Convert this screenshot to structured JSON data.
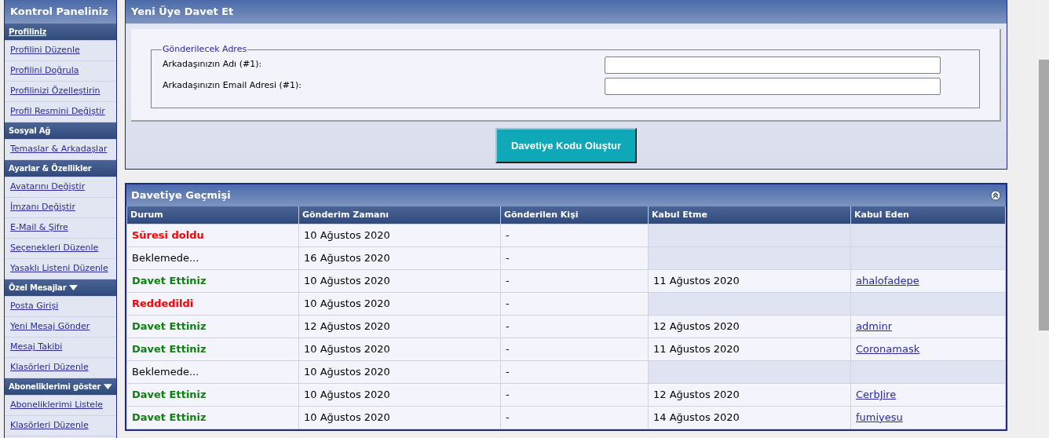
{
  "sidebar": {
    "title": "Kontrol Paneliniz",
    "sections": [
      {
        "label": "Profiliniz",
        "kind": "link",
        "items": [
          "Profilini Düzenle",
          "Profilini Doğrula",
          "Profilinizi Özelleştirin",
          "Profil Resmini Değiştir"
        ]
      },
      {
        "label": "Sosyal Ağ",
        "kind": "plain",
        "items": [
          "Temaslar & Arkadaşlar"
        ]
      },
      {
        "label": "Ayarlar & Özellikler",
        "kind": "plain",
        "items": [
          "Avatarını Değiştir",
          "İmzanı Değiştir",
          "E-Mail & Şifre",
          "Seçenekleri Düzenle",
          "Yasaklı Listeni Düzenle"
        ]
      },
      {
        "label": "Özel Mesajlar",
        "kind": "dropdown",
        "items": [
          "Posta Girişi",
          "Yeni Mesaj Gönder",
          "Mesaj Takibi",
          "Klasörleri Düzenle"
        ]
      },
      {
        "label": "Aboneliklerimi göster",
        "kind": "dropdown",
        "items": [
          "Aboneliklerimi Listele",
          "Klasörleri Düzenle"
        ]
      }
    ]
  },
  "invite": {
    "title": "Yeni Üye Davet Et",
    "legend": "Gönderilecek Adres",
    "fields": [
      {
        "label": "Arkadaşınızın Adı (#1):"
      },
      {
        "label": "Arkadaşınızın Email Adresi (#1):"
      }
    ],
    "button": "Davetiye Kodu Oluştur"
  },
  "history": {
    "title": "Davetiye Geçmişi",
    "columns": [
      "Durum",
      "Gönderim Zamanı",
      "Gönderilen Kişi",
      "Kabul Etme",
      "Kabul Eden"
    ],
    "rows": [
      {
        "status": "Süresi doldu",
        "kind": "expired",
        "sent": "10 Ağustos 2020",
        "recipient": "-"
      },
      {
        "status": "Beklemede...",
        "kind": "pending",
        "sent": "16 Ağustos 2020",
        "recipient": "-"
      },
      {
        "status": "Davet Ettiniz",
        "kind": "invited",
        "sent": "10 Ağustos 2020",
        "recipient": "-",
        "accepted": "11 Ağustos 2020",
        "user": "ahalofadepe"
      },
      {
        "status": "Reddedildi",
        "kind": "rejected",
        "sent": "10 Ağustos 2020",
        "recipient": "-"
      },
      {
        "status": "Davet Ettiniz",
        "kind": "invited",
        "sent": "12 Ağustos 2020",
        "recipient": "-",
        "accepted": "12 Ağustos 2020",
        "user": "adminr"
      },
      {
        "status": "Davet Ettiniz",
        "kind": "invited",
        "sent": "10 Ağustos 2020",
        "recipient": "-",
        "accepted": "11 Ağustos 2020",
        "user": "Coronamask"
      },
      {
        "status": "Beklemede...",
        "kind": "pending",
        "sent": "10 Ağustos 2020",
        "recipient": "-"
      },
      {
        "status": "Davet Ettiniz",
        "kind": "invited",
        "sent": "10 Ağustos 2020",
        "recipient": "-",
        "accepted": "12 Ağustos 2020",
        "user": "CerbJire"
      },
      {
        "status": "Davet Ettiniz",
        "kind": "invited",
        "sent": "10 Ağustos 2020",
        "recipient": "-",
        "accepted": "14 Ağustos 2020",
        "user": "fumiyesu"
      }
    ]
  }
}
